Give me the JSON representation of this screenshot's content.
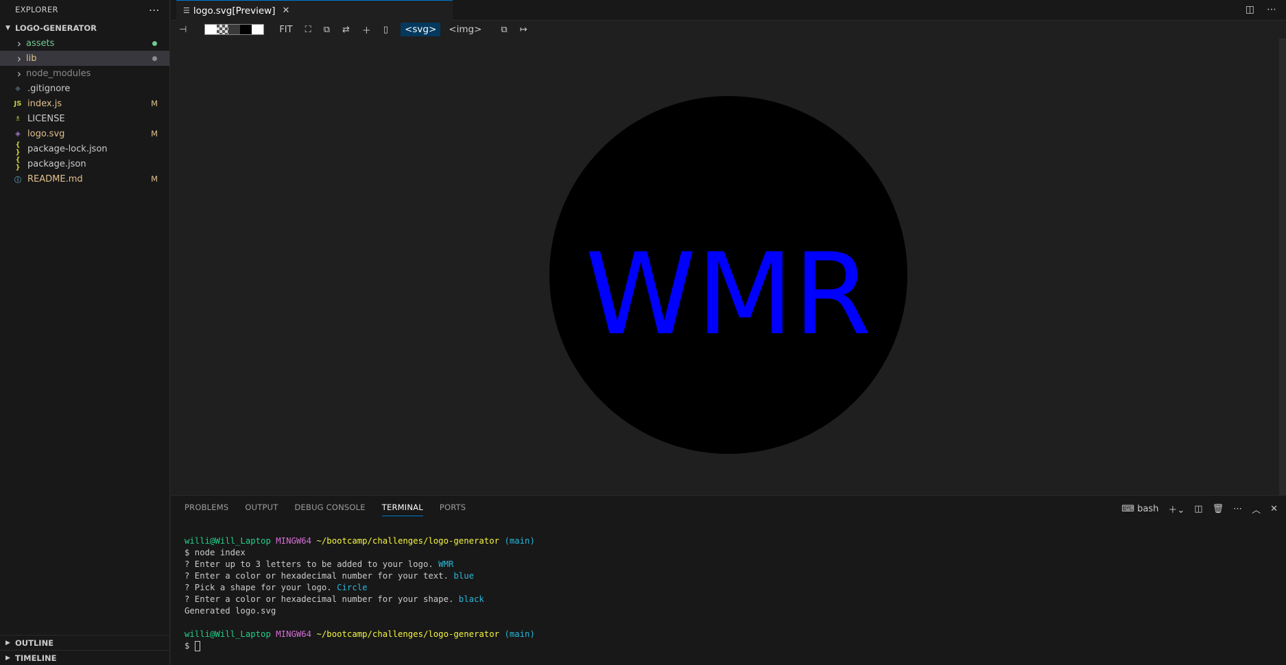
{
  "explorer": {
    "title": "EXPLORER",
    "folder": "LOGO-GENERATOR",
    "items": [
      {
        "label": "assets",
        "type": "folder",
        "color": "#73c991",
        "decoration": "dot",
        "deco_color": "#73c991"
      },
      {
        "label": "lib",
        "type": "folder",
        "color": "#e2c08d",
        "decoration": "dot",
        "deco_color": "#8c8c8c",
        "selected": true
      },
      {
        "label": "node_modules",
        "type": "folder",
        "color": "#8c8c8c",
        "decoration": ""
      },
      {
        "label": ".gitignore",
        "type": "file",
        "icon": "git-icon",
        "glyph": "◆",
        "icon_color": "#41535b",
        "color": "#cccccc",
        "decoration": ""
      },
      {
        "label": "index.js",
        "type": "file",
        "icon": "js-icon",
        "glyph": "JS",
        "icon_color": "#cbcb41",
        "color": "#e2c08d",
        "decoration": "M"
      },
      {
        "label": "LICENSE",
        "type": "file",
        "icon": "license-icon",
        "glyph": "♗",
        "icon_color": "#cbcb41",
        "color": "#cccccc",
        "decoration": ""
      },
      {
        "label": "logo.svg",
        "type": "file",
        "icon": "svg-icon",
        "glyph": "◈",
        "icon_color": "#a074c4",
        "color": "#e2c08d",
        "decoration": "M"
      },
      {
        "label": "package-lock.json",
        "type": "file",
        "icon": "json-icon",
        "glyph": "{ }",
        "icon_color": "#cbcb41",
        "color": "#cccccc",
        "decoration": ""
      },
      {
        "label": "package.json",
        "type": "file",
        "icon": "json-icon",
        "glyph": "{ }",
        "icon_color": "#cbcb41",
        "color": "#cccccc",
        "decoration": ""
      },
      {
        "label": "README.md",
        "type": "file",
        "icon": "info-icon",
        "glyph": "ⓘ",
        "icon_color": "#519aba",
        "color": "#e2c08d",
        "decoration": "M"
      }
    ],
    "outline": "OUTLINE",
    "timeline": "TIMELINE"
  },
  "editor": {
    "tab_label": "logo.svg[Preview]",
    "toolbar": {
      "fit": "FIT",
      "svg_format": "<svg>",
      "img_format": "<img>"
    },
    "preview": {
      "text": "WMR",
      "text_color": "#0000ff",
      "shape": "circle",
      "shape_color": "#000000"
    }
  },
  "panel": {
    "tabs": [
      "PROBLEMS",
      "OUTPUT",
      "DEBUG CONSOLE",
      "TERMINAL",
      "PORTS"
    ],
    "active_tab": "TERMINAL",
    "shell": "bash",
    "terminal": {
      "user_host": "willi@Will_Laptop",
      "system": "MINGW64",
      "path": "~/bootcamp/challenges/logo-generator",
      "branch": "(main)",
      "command": "$ node index",
      "prompts": [
        {
          "q": "? Enter up to 3 letters to be added to your logo.",
          "a": "WMR"
        },
        {
          "q": "? Enter a color or hexadecimal number for your text.",
          "a": "blue"
        },
        {
          "q": "? Pick a shape for your logo.",
          "a": "Circle"
        },
        {
          "q": "? Enter a color or hexadecimal number for your shape.",
          "a": "black"
        }
      ],
      "result": "Generated logo.svg",
      "final_prompt": "$"
    }
  }
}
